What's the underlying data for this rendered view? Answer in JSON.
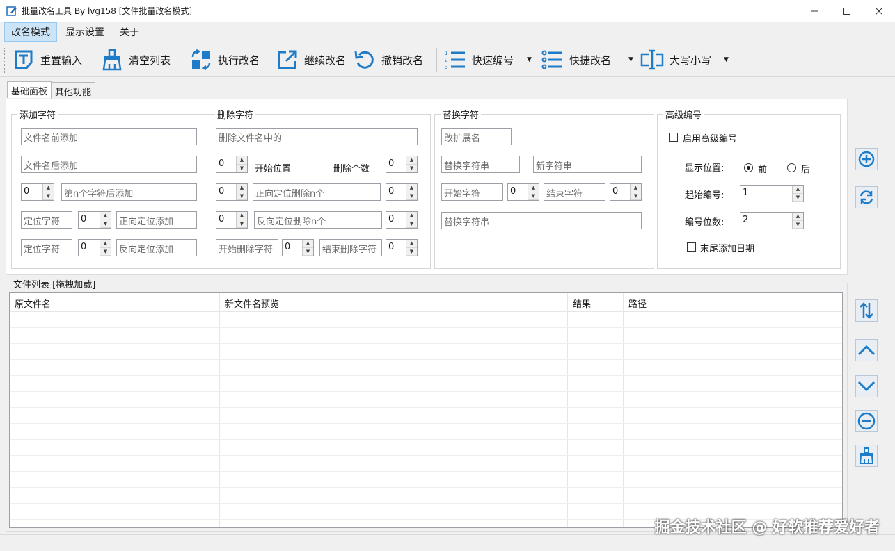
{
  "window": {
    "title": "批量改名工具  By lvg158    [文件批量改名模式]",
    "controls": [
      "minimize-icon",
      "maximize-icon",
      "close-icon"
    ]
  },
  "menu": [
    {
      "label": "改名模式",
      "active": true
    },
    {
      "label": "显示设置",
      "active": false
    },
    {
      "label": "关于",
      "active": false
    }
  ],
  "toolbar": {
    "reset_input": "重置输入",
    "clear_list": "清空列表",
    "execute_rename": "执行改名",
    "continue_rename": "继续改名",
    "undo_rename": "撤销改名",
    "quick_number": "快速编号",
    "quick_rename": "快捷改名",
    "case": "大写小写",
    "accent": "#1e7bc8"
  },
  "tabs": [
    {
      "label": "基础面板",
      "active": true
    },
    {
      "label": "其他功能",
      "active": false
    }
  ],
  "add_chars": {
    "legend": "添加字符",
    "prefix_placeholder": "文件名前添加",
    "suffix_placeholder": "文件名后添加",
    "nth_value": "0",
    "nth_placeholder": "第n个字符后添加",
    "locate1_placeholder": "定位字符",
    "locate1_value": "0",
    "forward_add_placeholder": "正向定位添加",
    "locate2_placeholder": "定位字符",
    "locate2_value": "0",
    "reverse_add_placeholder": "反向定位添加"
  },
  "delete_chars": {
    "legend": "删除字符",
    "delete_in_placeholder": "删除文件名中的",
    "start_value": "0",
    "start_label": "开始位置",
    "count_label": "删除个数",
    "count_value": "0",
    "fwd_value": "0",
    "fwd_placeholder": "正向定位删除n个",
    "fwd_count": "0",
    "rev_value": "0",
    "rev_placeholder": "反向定位删除n个",
    "rev_count": "0",
    "start_char_placeholder": "开始删除字符",
    "mid_value": "0",
    "end_char_placeholder": "结束删除字符",
    "end_value": "0"
  },
  "replace_chars": {
    "legend": "替换字符",
    "ext_placeholder": "改扩展名",
    "replace_placeholder": "替换字符串",
    "new_placeholder": "新字符串",
    "start_char_placeholder": "开始字符",
    "start_value": "0",
    "end_char_placeholder": "结束字符",
    "end_value": "0",
    "replace2_placeholder": "替换字符串"
  },
  "advanced_number": {
    "legend": "高级编号",
    "enable_label": "启用高级编号",
    "position_label": "显示位置:",
    "before_label": "前",
    "after_label": "后",
    "start_label": "起始编号:",
    "start_value": "1",
    "digits_label": "编号位数:",
    "digits_value": "2",
    "date_label": "末尾添加日期"
  },
  "file_list": {
    "label": "文件列表 [拖拽加载]",
    "columns": [
      "原文件名",
      "新文件名预览",
      "结果",
      "路径"
    ]
  },
  "watermark": "掘金技术社区 @ 好软推荐爱好者"
}
